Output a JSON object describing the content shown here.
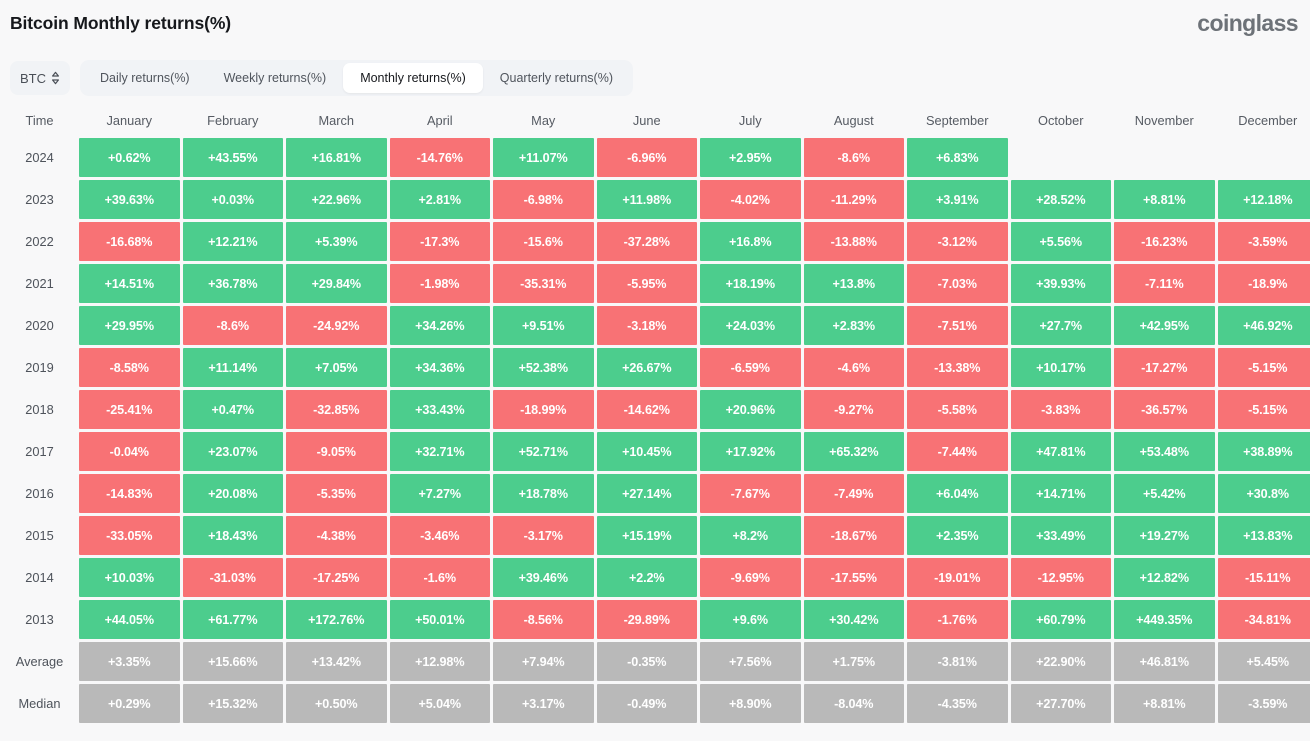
{
  "header": {
    "title": "Bitcoin Monthly returns(%)",
    "brand": "coinglass"
  },
  "toolbar": {
    "coin": "BTC",
    "coin_icon": "chevron-up-down-icon",
    "tabs": [
      {
        "label": "Daily returns(%)",
        "active": false
      },
      {
        "label": "Weekly returns(%)",
        "active": false
      },
      {
        "label": "Monthly returns(%)",
        "active": true
      },
      {
        "label": "Quarterly returns(%)",
        "active": false
      }
    ]
  },
  "colors": {
    "positive": "#4ccd8d",
    "negative": "#f87275",
    "neutral": "#b9b9b9",
    "background": "#f8f8f9",
    "tab_bar": "#f1f3f6"
  },
  "chart_data": {
    "type": "heatmap",
    "title": "Bitcoin Monthly returns(%)",
    "xlabel": "",
    "ylabel": "Time",
    "row_header": "Time",
    "categories": [
      "January",
      "February",
      "March",
      "April",
      "May",
      "June",
      "July",
      "August",
      "September",
      "October",
      "November",
      "December"
    ],
    "rows": [
      {
        "label": "2024",
        "kind": "year",
        "values": [
          "+0.62%",
          "+43.55%",
          "+16.81%",
          "-14.76%",
          "+11.07%",
          "-6.96%",
          "+2.95%",
          "-8.6%",
          "+6.83%",
          "",
          "",
          ""
        ]
      },
      {
        "label": "2023",
        "kind": "year",
        "values": [
          "+39.63%",
          "+0.03%",
          "+22.96%",
          "+2.81%",
          "-6.98%",
          "+11.98%",
          "-4.02%",
          "-11.29%",
          "+3.91%",
          "+28.52%",
          "+8.81%",
          "+12.18%"
        ]
      },
      {
        "label": "2022",
        "kind": "year",
        "values": [
          "-16.68%",
          "+12.21%",
          "+5.39%",
          "-17.3%",
          "-15.6%",
          "-37.28%",
          "+16.8%",
          "-13.88%",
          "-3.12%",
          "+5.56%",
          "-16.23%",
          "-3.59%"
        ]
      },
      {
        "label": "2021",
        "kind": "year",
        "values": [
          "+14.51%",
          "+36.78%",
          "+29.84%",
          "-1.98%",
          "-35.31%",
          "-5.95%",
          "+18.19%",
          "+13.8%",
          "-7.03%",
          "+39.93%",
          "-7.11%",
          "-18.9%"
        ]
      },
      {
        "label": "2020",
        "kind": "year",
        "values": [
          "+29.95%",
          "-8.6%",
          "-24.92%",
          "+34.26%",
          "+9.51%",
          "-3.18%",
          "+24.03%",
          "+2.83%",
          "-7.51%",
          "+27.7%",
          "+42.95%",
          "+46.92%"
        ]
      },
      {
        "label": "2019",
        "kind": "year",
        "values": [
          "-8.58%",
          "+11.14%",
          "+7.05%",
          "+34.36%",
          "+52.38%",
          "+26.67%",
          "-6.59%",
          "-4.6%",
          "-13.38%",
          "+10.17%",
          "-17.27%",
          "-5.15%"
        ]
      },
      {
        "label": "2018",
        "kind": "year",
        "values": [
          "-25.41%",
          "+0.47%",
          "-32.85%",
          "+33.43%",
          "-18.99%",
          "-14.62%",
          "+20.96%",
          "-9.27%",
          "-5.58%",
          "-3.83%",
          "-36.57%",
          "-5.15%"
        ]
      },
      {
        "label": "2017",
        "kind": "year",
        "values": [
          "-0.04%",
          "+23.07%",
          "-9.05%",
          "+32.71%",
          "+52.71%",
          "+10.45%",
          "+17.92%",
          "+65.32%",
          "-7.44%",
          "+47.81%",
          "+53.48%",
          "+38.89%"
        ]
      },
      {
        "label": "2016",
        "kind": "year",
        "values": [
          "-14.83%",
          "+20.08%",
          "-5.35%",
          "+7.27%",
          "+18.78%",
          "+27.14%",
          "-7.67%",
          "-7.49%",
          "+6.04%",
          "+14.71%",
          "+5.42%",
          "+30.8%"
        ]
      },
      {
        "label": "2015",
        "kind": "year",
        "values": [
          "-33.05%",
          "+18.43%",
          "-4.38%",
          "-3.46%",
          "-3.17%",
          "+15.19%",
          "+8.2%",
          "-18.67%",
          "+2.35%",
          "+33.49%",
          "+19.27%",
          "+13.83%"
        ]
      },
      {
        "label": "2014",
        "kind": "year",
        "values": [
          "+10.03%",
          "-31.03%",
          "-17.25%",
          "-1.6%",
          "+39.46%",
          "+2.2%",
          "-9.69%",
          "-17.55%",
          "-19.01%",
          "-12.95%",
          "+12.82%",
          "-15.11%"
        ]
      },
      {
        "label": "2013",
        "kind": "year",
        "values": [
          "+44.05%",
          "+61.77%",
          "+172.76%",
          "+50.01%",
          "-8.56%",
          "-29.89%",
          "+9.6%",
          "+30.42%",
          "-1.76%",
          "+60.79%",
          "+449.35%",
          "-34.81%"
        ]
      },
      {
        "label": "Average",
        "kind": "stat",
        "values": [
          "+3.35%",
          "+15.66%",
          "+13.42%",
          "+12.98%",
          "+7.94%",
          "-0.35%",
          "+7.56%",
          "+1.75%",
          "-3.81%",
          "+22.90%",
          "+46.81%",
          "+5.45%"
        ]
      },
      {
        "label": "Median",
        "kind": "stat",
        "values": [
          "+0.29%",
          "+15.32%",
          "+0.50%",
          "+5.04%",
          "+3.17%",
          "-0.49%",
          "+8.90%",
          "-8.04%",
          "-4.35%",
          "+27.70%",
          "+8.81%",
          "-3.59%"
        ]
      }
    ]
  }
}
